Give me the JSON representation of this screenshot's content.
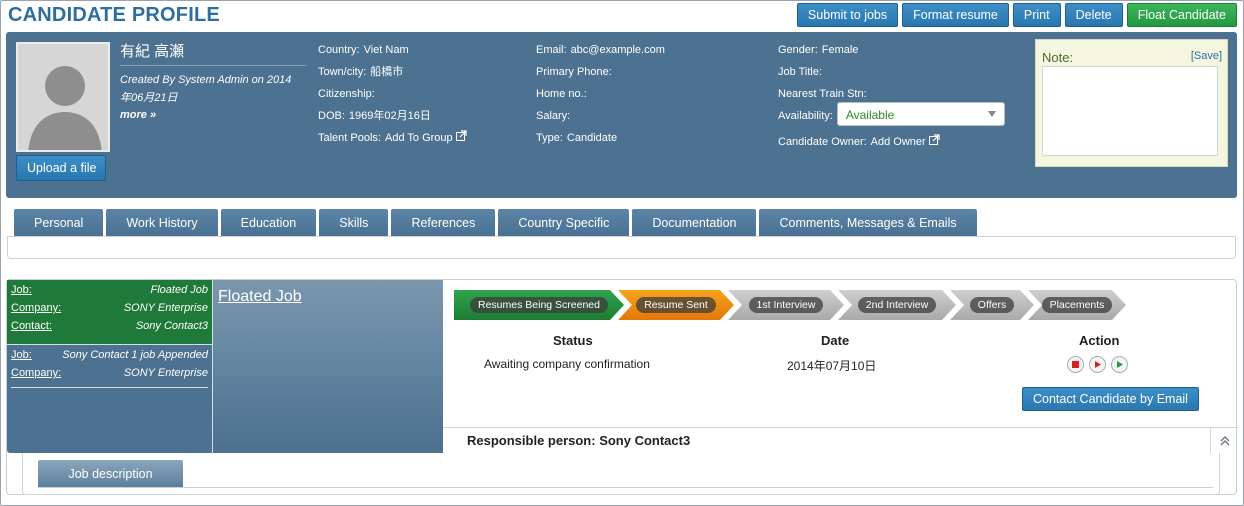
{
  "header": {
    "title": "CANDIDATE PROFILE",
    "buttons": [
      "Submit to jobs",
      "Format resume",
      "Print",
      "Delete",
      "Float Candidate"
    ]
  },
  "profile": {
    "name": "有紀 高瀬",
    "created_line1": "Created By System Admin on 2014",
    "created_line2": "年06月21日",
    "more": "more »",
    "upload_label": "Upload a file",
    "col1": {
      "country_label": "Country:",
      "country": "Viet Nam",
      "town_label": "Town/city:",
      "town": "船橋市",
      "citizenship_label": "Citizenship:",
      "dob_label": "DOB:",
      "dob": "1969年02月16日",
      "pools_label": "Talent Pools:",
      "pools_link": "Add To Group"
    },
    "col2": {
      "email_label": "Email:",
      "email": "abc@example.com",
      "primary_phone_label": "Primary Phone:",
      "home_label": "Home no.:",
      "salary_label": "Salary:",
      "type_label": "Type:",
      "type": "Candidate"
    },
    "col3": {
      "gender_label": "Gender:",
      "gender": "Female",
      "job_title_label": "Job Title:",
      "train_label": "Nearest Train Stn:",
      "availability_label": "Availability:",
      "availability": "Available",
      "owner_label": "Candidate Owner:",
      "owner_link": "Add Owner"
    },
    "note": {
      "label": "Note:",
      "save": "[Save]"
    }
  },
  "tabs": [
    "Personal",
    "Work History",
    "Education",
    "Skills",
    "References",
    "Country Specific",
    "Documentation",
    "Comments, Messages & Emails"
  ],
  "jobs": {
    "items": [
      {
        "job_label": "Job:",
        "job": "Floated Job",
        "company_label": "Company:",
        "company": "SONY Enterprise",
        "contact_label": "Contact:",
        "contact": "Sony Contact3"
      },
      {
        "job_label": "Job:",
        "job": "Sony Contact 1 job Appended",
        "company_label": "Company:",
        "company": "SONY Enterprise"
      }
    ],
    "selected_title": "Floated Job"
  },
  "pipeline": {
    "stages": [
      "Resumes Being Screened",
      "Resume Sent",
      "1st Interview",
      "2nd Interview",
      "Offers",
      "Placements"
    ],
    "status_header": "Status",
    "date_header": "Date",
    "action_header": "Action",
    "status": "Awaiting company confirmation",
    "date": "2014年07月10日",
    "contact_button": "Contact Candidate by Email",
    "responsible": "Responsible person: Sony Contact3"
  },
  "job_description_tab": "Job description",
  "colors": {
    "panel": "#4d7190",
    "accent": "#2e6e9e",
    "green": "#23993f",
    "orange": "#f28c12"
  }
}
